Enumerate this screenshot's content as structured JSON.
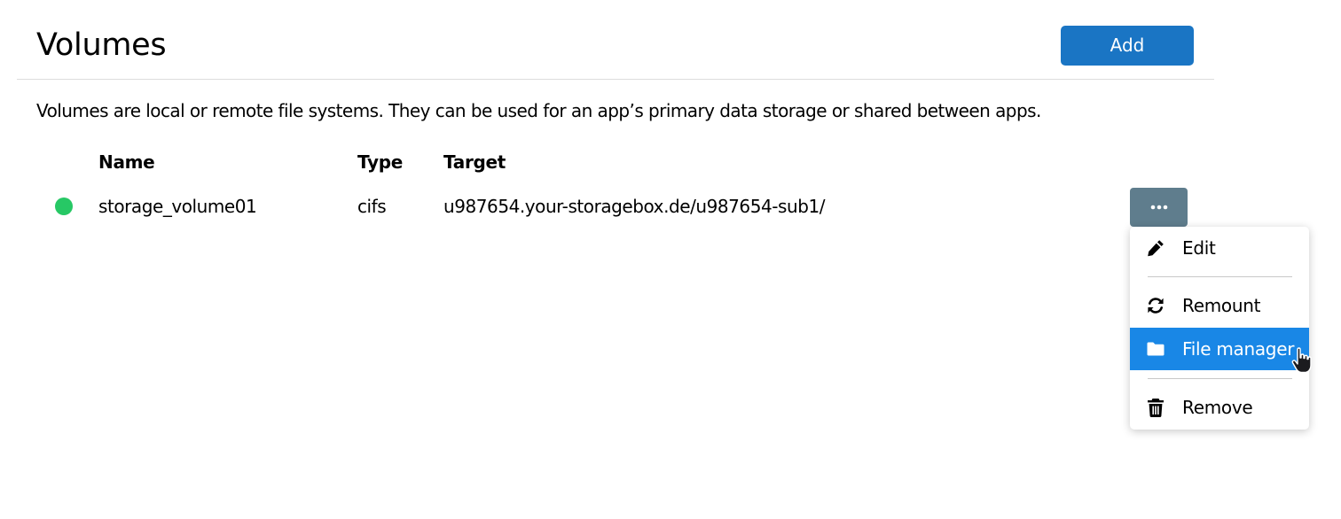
{
  "header": {
    "title": "Volumes",
    "add_label": "Add"
  },
  "description": "Volumes are local or remote file systems. They can be used for an app’s primary data storage or shared between apps.",
  "table": {
    "columns": [
      "Name",
      "Type",
      "Target"
    ],
    "rows": [
      {
        "status": "green",
        "name": "storage_volume01",
        "type": "cifs",
        "target": "u987654.your-storagebox.de/u987654-sub1/"
      }
    ]
  },
  "actions_menu": {
    "trigger_icon": "more-horizontal-icon",
    "items": [
      {
        "label": "Edit",
        "icon": "pencil-icon"
      },
      {
        "label": "Remount",
        "icon": "sync-icon"
      },
      {
        "label": "File manager",
        "icon": "folder-icon",
        "highlighted": true
      },
      {
        "label": "Remove",
        "icon": "trash-icon"
      }
    ]
  },
  "colors": {
    "primary": "#1a75c4",
    "more_button": "#5f7d8d",
    "status_ok": "#27c865",
    "menu_highlight": "#1987e6"
  }
}
